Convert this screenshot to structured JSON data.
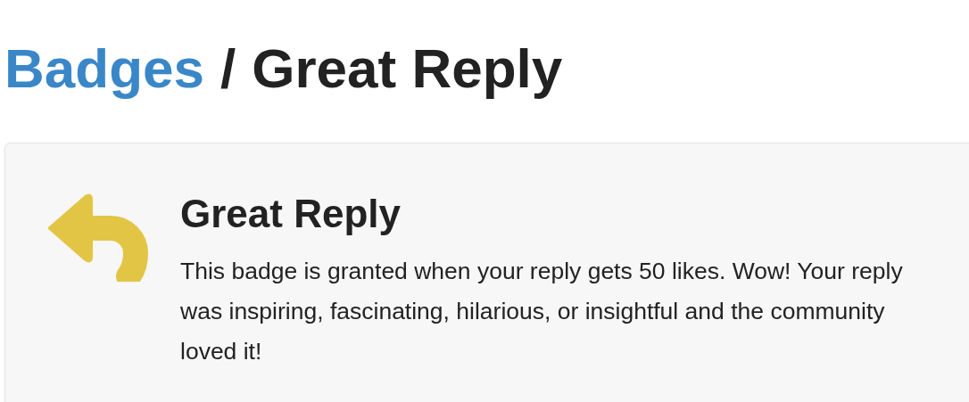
{
  "breadcrumb": {
    "parent": "Badges",
    "separator": "/",
    "current": "Great Reply"
  },
  "badge": {
    "name": "Great Reply",
    "description": "This badge is granted when your reply gets 50 likes. Wow! Your reply was inspiring, fascinating, hilarious, or insightful and the community loved it!"
  }
}
